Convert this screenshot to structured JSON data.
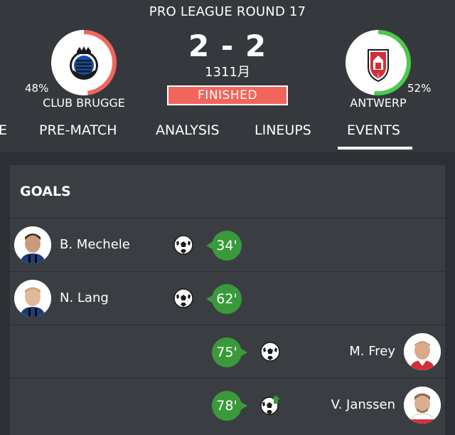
{
  "match": {
    "round_title": "PRO LEAGUE ROUND 17",
    "score": "2 - 2",
    "date": "1311月",
    "status": "FINISHED",
    "home": {
      "name": "CLUB BRUGGE",
      "possession_label": "48%",
      "possession": 0.48,
      "ring_color": "#f2655c",
      "crest_icon": "club-brugge-crest-icon"
    },
    "away": {
      "name": "ANTWERP",
      "possession_label": "52%",
      "possession": 0.52,
      "ring_color": "#4cc94c",
      "crest_icon": "antwerp-crest-icon"
    }
  },
  "tabs": [
    {
      "label": "E"
    },
    {
      "label": "PRE-MATCH"
    },
    {
      "label": "ANALYSIS"
    },
    {
      "label": "LINEUPS"
    },
    {
      "label": "EVENTS",
      "active": true
    }
  ],
  "goals": {
    "title": "GOALS",
    "events": [
      {
        "player": "B. Mechele",
        "minute": "34'",
        "side": "home",
        "icon": "football-icon"
      },
      {
        "player": "N. Lang",
        "minute": "62'",
        "side": "home",
        "icon": "football-icon"
      },
      {
        "player": "M. Frey",
        "minute": "75'",
        "side": "away",
        "icon": "football-icon"
      },
      {
        "player": "V. Janssen",
        "minute": "78'",
        "side": "away",
        "icon": "penalty-ball-icon"
      }
    ]
  },
  "colors": {
    "background": "#2c2f33",
    "header": "#35393d",
    "card": "#3a3e42",
    "minute_badge": "#3a9a3b",
    "status_badge": "#f2655c"
  }
}
